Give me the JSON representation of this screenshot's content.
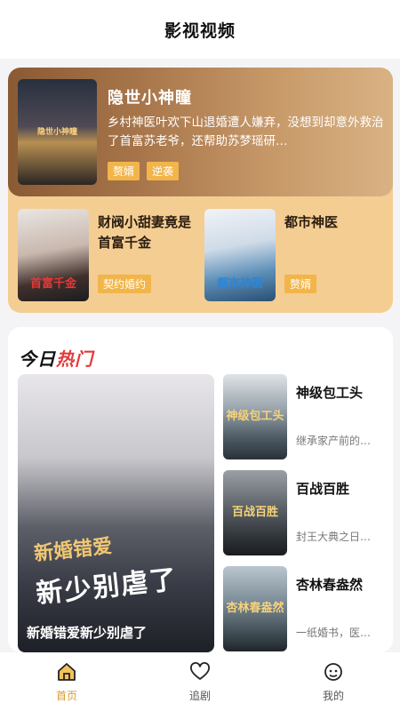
{
  "header": {
    "title": "影视视频"
  },
  "featured": {
    "title": "隐世小神瞳",
    "description": "乡村神医叶欢下山退婚遭人嫌弃，没想到却意外救治了首富苏老爷，还帮助苏梦瑶研…",
    "poster_text": "隐世小神瞳",
    "tags": [
      "赘婿",
      "逆袭"
    ]
  },
  "sub_items": [
    {
      "title": "财阀小甜妻竟是首富千金",
      "poster_text": "首富千金",
      "tags": [
        "契约婚约"
      ]
    },
    {
      "title": "都市神医",
      "poster_text": "都市神医",
      "tags": [
        "赘婿"
      ]
    }
  ],
  "hot": {
    "heading_a": "今日",
    "heading_b": "热门",
    "big": {
      "title": "新婚错爱新少别虐了",
      "art_line1": "新婚错爱",
      "art_line2": "新少别虐了"
    },
    "items": [
      {
        "title": "神级包工头",
        "description": "继承家产前的…",
        "poster_text": "神级包工头"
      },
      {
        "title": "百战百胜",
        "description": "封王大典之日…",
        "poster_text": "百战百胜"
      },
      {
        "title": "杏林春盎然",
        "description": "一纸婚书，医…",
        "poster_text": "杏林春盎然"
      }
    ]
  },
  "nav": {
    "items": [
      {
        "label": "首页",
        "icon": "home-icon",
        "active": true
      },
      {
        "label": "追剧",
        "icon": "heart-icon",
        "active": false
      },
      {
        "label": "我的",
        "icon": "profile-icon",
        "active": false
      }
    ],
    "active_color": "#d99a2b"
  }
}
